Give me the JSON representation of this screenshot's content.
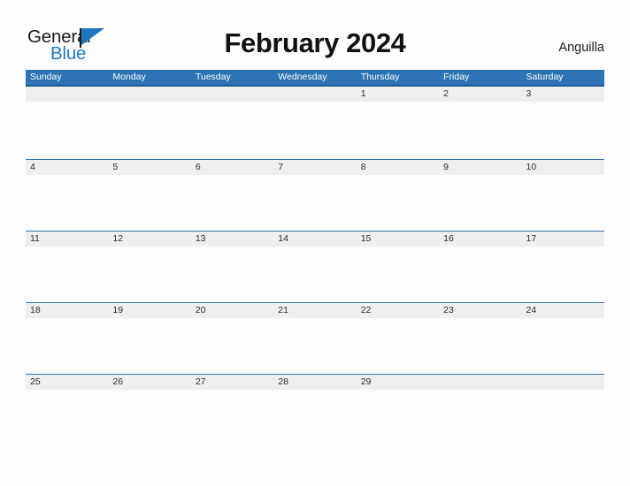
{
  "brand": {
    "name_part1": "General",
    "name_part2": "Blue",
    "primary_color": "#1f76bd",
    "flag_icon": "flag-triangle-icon"
  },
  "header": {
    "title": "February 2024",
    "region": "Anguilla"
  },
  "calendar": {
    "month": "February",
    "year": "2024",
    "header_bg_color": "#2e74b5",
    "date_band_color": "#efefef",
    "weekdays": [
      "Sunday",
      "Monday",
      "Tuesday",
      "Wednesday",
      "Thursday",
      "Friday",
      "Saturday"
    ],
    "weeks": [
      [
        "",
        "",
        "",
        "",
        "1",
        "2",
        "3"
      ],
      [
        "4",
        "5",
        "6",
        "7",
        "8",
        "9",
        "10"
      ],
      [
        "11",
        "12",
        "13",
        "14",
        "15",
        "16",
        "17"
      ],
      [
        "18",
        "19",
        "20",
        "21",
        "22",
        "23",
        "24"
      ],
      [
        "25",
        "26",
        "27",
        "28",
        "29",
        "",
        ""
      ]
    ]
  }
}
